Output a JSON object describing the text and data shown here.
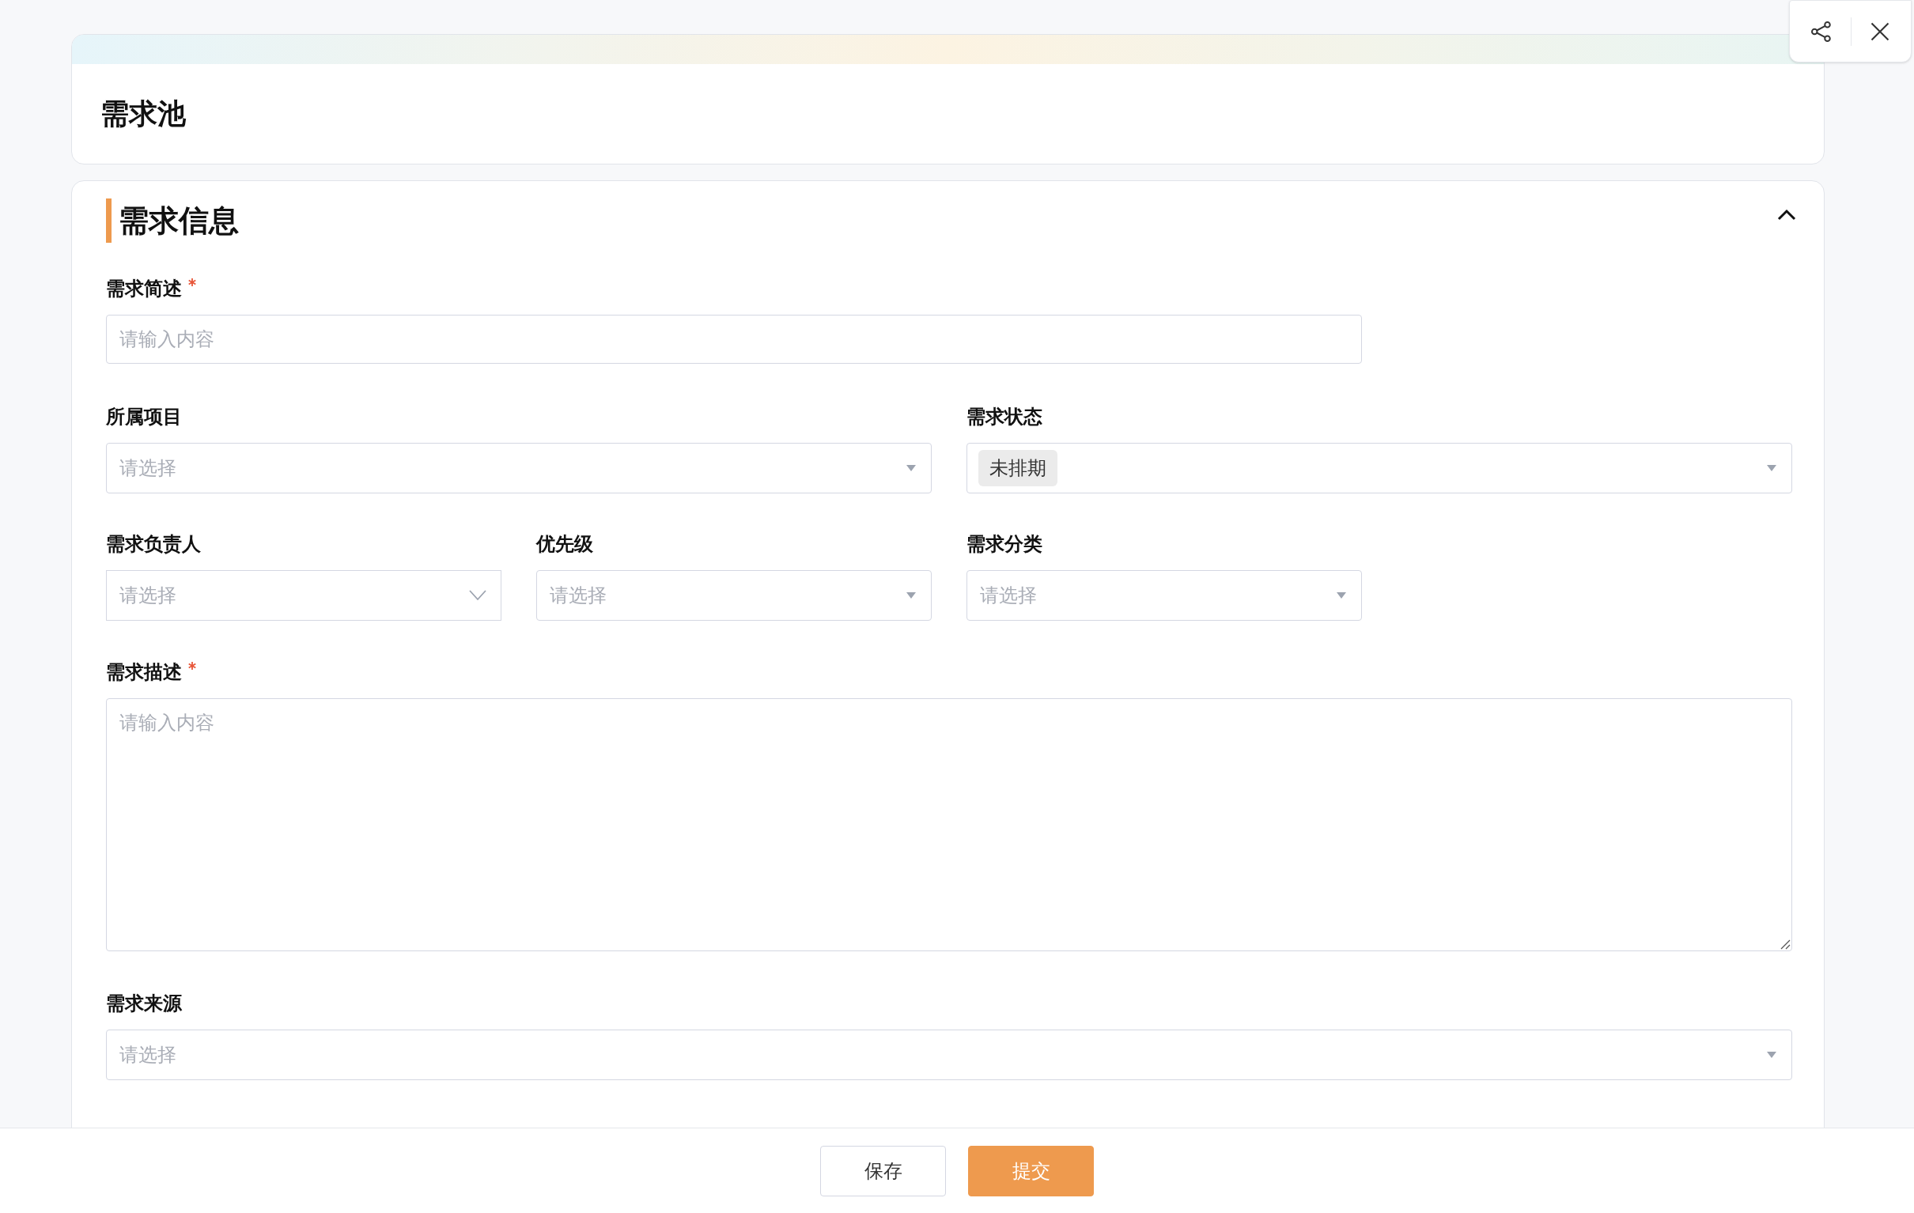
{
  "page": {
    "title": "需求池"
  },
  "section": {
    "title": "需求信息",
    "expanded": true
  },
  "rows": [
    [
      {
        "label": "需求简述",
        "required": true,
        "kind": "input",
        "placeholder": "请输入内容"
      }
    ],
    [
      {
        "label": "所属项目",
        "required": false,
        "kind": "select",
        "placeholder": "请选择"
      },
      {
        "label": "需求状态",
        "required": false,
        "kind": "select",
        "value": "未排期"
      }
    ],
    [
      {
        "label": "需求负责人",
        "required": false,
        "kind": "person-select",
        "placeholder": "请选择"
      },
      {
        "label": "优先级",
        "required": false,
        "kind": "select",
        "placeholder": "请选择"
      },
      {
        "label": "需求分类",
        "required": false,
        "kind": "select",
        "placeholder": "请选择"
      }
    ],
    [
      {
        "label": "需求描述",
        "required": true,
        "kind": "textarea",
        "placeholder": "请输入内容"
      }
    ],
    [
      {
        "label": "需求来源",
        "required": false,
        "kind": "select",
        "placeholder": "请选择"
      }
    ]
  ],
  "footer": {
    "buttons": [
      {
        "label": "保存",
        "kind": "secondary"
      },
      {
        "label": "提交",
        "kind": "primary"
      }
    ]
  }
}
